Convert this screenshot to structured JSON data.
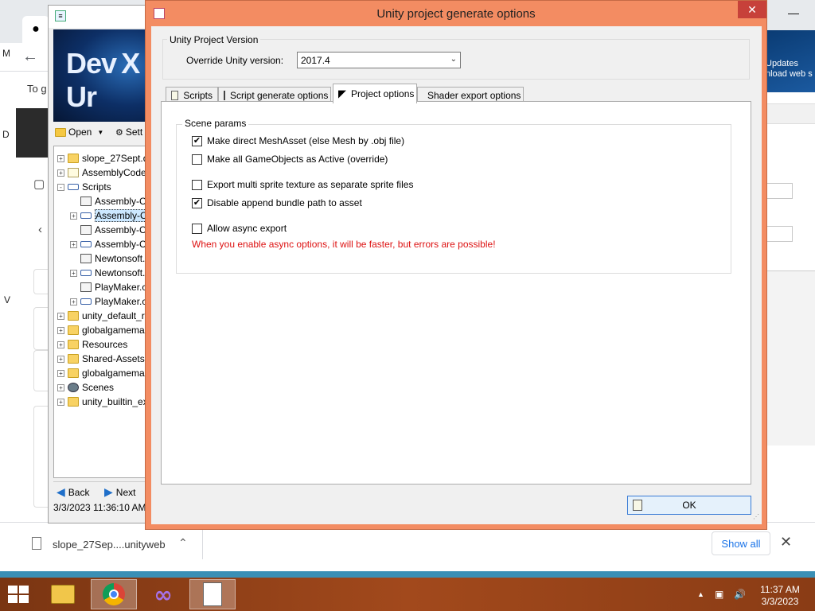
{
  "browser": {
    "left_text": "To g",
    "right_banner": [
      "Updates",
      "nload web s"
    ],
    "side_letters": [
      "M",
      "D",
      "V"
    ],
    "downloads": {
      "filename": "slope_27Sep....unityweb",
      "show_all": "Show all"
    }
  },
  "asset_window": {
    "banner_text": "Dev X Ur",
    "toolbar": {
      "open": "Open",
      "settings": "Sett"
    },
    "tree": [
      {
        "label": "slope_27Sept.d",
        "icon": "folder-icon",
        "expander": "+"
      },
      {
        "label": "AssemblyCode",
        "icon": "file-icon",
        "expander": "+"
      },
      {
        "label": "Scripts",
        "icon": "assembly-icon",
        "expander": "-"
      },
      {
        "label": "Assembly-C",
        "icon": "script-icon",
        "expander": ""
      },
      {
        "label": "Assembly-C",
        "icon": "assembly-icon",
        "expander": "+",
        "selected": true
      },
      {
        "label": "Assembly-C",
        "icon": "script-icon",
        "expander": ""
      },
      {
        "label": "Assembly-C",
        "icon": "assembly-icon",
        "expander": "+"
      },
      {
        "label": "Newtonsoft.",
        "icon": "script-icon",
        "expander": ""
      },
      {
        "label": "Newtonsoft.",
        "icon": "assembly-icon",
        "expander": "+"
      },
      {
        "label": "PlayMaker.c",
        "icon": "script-icon",
        "expander": ""
      },
      {
        "label": "PlayMaker.c",
        "icon": "assembly-icon",
        "expander": "+"
      },
      {
        "label": "unity_default_r",
        "icon": "folder-icon",
        "expander": "+"
      },
      {
        "label": "globalgamemar",
        "icon": "folder-icon",
        "expander": "+"
      },
      {
        "label": "Resources",
        "icon": "folder-icon",
        "expander": "+"
      },
      {
        "label": "Shared-Assets",
        "icon": "folder-icon",
        "expander": "+"
      },
      {
        "label": "globalgamemar",
        "icon": "folder-icon",
        "expander": "+"
      },
      {
        "label": "Scenes",
        "icon": "scene-icon",
        "expander": "+"
      },
      {
        "label": "unity_builtin_ex",
        "icon": "folder-icon",
        "expander": "+"
      }
    ],
    "nav": {
      "back": "Back",
      "next": "Next"
    },
    "status": "3/3/2023 11:36:10 AM"
  },
  "dialog": {
    "title": "Unity project generate options",
    "close_glyph": "✕",
    "version_group": "Unity Project Version",
    "override_label": "Override Unity version:",
    "override_value": "2017.4",
    "tabs": [
      {
        "label": "Scripts",
        "icon": "document-icon",
        "active": false
      },
      {
        "label": "Script generate options",
        "icon": "script-icon",
        "active": false
      },
      {
        "label": "Project options",
        "icon": "unity-icon",
        "active": true
      },
      {
        "label": "Shader export options",
        "icon": "shader-icon",
        "active": false
      }
    ],
    "scene_group": "Scene params",
    "checkboxes": [
      {
        "label": "Make direct MeshAsset (else Mesh by .obj file)",
        "checked": true
      },
      {
        "label": "Make all GameObjects as Active (override)",
        "checked": false
      },
      {
        "label": "Export multi sprite texture as separate sprite files",
        "checked": false
      },
      {
        "label": "Disable append bundle path to asset",
        "checked": true
      },
      {
        "label": "Allow async export",
        "checked": false
      }
    ],
    "warning": "When you enable async options, it will be faster, but errors are possible!",
    "ok_label": "OK"
  },
  "taskbar": {
    "time": "11:37 AM",
    "date": "3/3/2023",
    "apps": [
      "file-explorer-icon",
      "chrome-icon",
      "visual-studio-icon",
      "assetstudio-icon"
    ]
  },
  "colors": {
    "dialog_frame": "#f38c62",
    "close_button": "#c7413a",
    "warning_text": "#dd1111",
    "ok_border": "#3a7bd5",
    "taskbar": "#a2491c"
  }
}
